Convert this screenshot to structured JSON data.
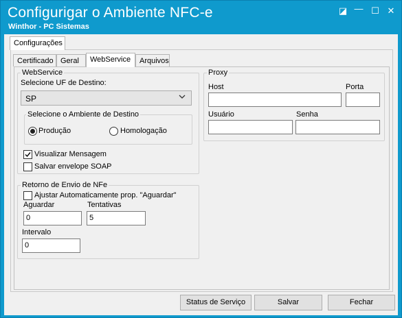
{
  "window": {
    "title": "Configurigar o Ambiente NFC-e",
    "subtitle": "Winthor - PC Sistemas",
    "restore_glyph": "◪",
    "minimize_glyph": "—",
    "maximize_glyph": "☐",
    "close_glyph": "✕"
  },
  "top_tab": {
    "label": "Configurações"
  },
  "tabs": [
    {
      "label": "Certificado",
      "active": false
    },
    {
      "label": "Geral",
      "active": false
    },
    {
      "label": "WebService",
      "active": true
    },
    {
      "label": "Arquivos",
      "active": false
    }
  ],
  "webservice": {
    "legend": "WebService",
    "uf_label": "Selecione UF de Destino:",
    "uf_value": "SP",
    "ambiente_legend": "Selecione o Ambiente de Destino",
    "producao_label": "Produção",
    "producao_selected": true,
    "homologacao_label": "Homologação",
    "homologacao_selected": false,
    "visualizar_label": "Visualizar Mensagem",
    "visualizar_checked": true,
    "salvar_envelope_label": "Salvar envelope SOAP",
    "salvar_envelope_checked": false
  },
  "proxy": {
    "legend": "Proxy",
    "host_label": "Host",
    "host_value": "",
    "porta_label": "Porta",
    "porta_value": "",
    "usuario_label": "Usuário",
    "usuario_value": "",
    "senha_label": "Senha",
    "senha_value": ""
  },
  "retorno": {
    "legend": "Retorno de Envio de NFe",
    "ajustar_label": "Ajustar Automaticamente prop. \"Aguardar\"",
    "ajustar_checked": false,
    "aguardar_label": "Aguardar",
    "aguardar_value": "0",
    "tentativas_label": "Tentativas",
    "tentativas_value": "5",
    "intervalo_label": "Intervalo",
    "intervalo_value": "0"
  },
  "buttons": {
    "status_label": "Status de Serviço",
    "salvar_label": "Salvar",
    "fechar_label": "Fechar"
  },
  "colors": {
    "title_bar": "#0f9acd",
    "client_bg": "#f0f0f0"
  }
}
